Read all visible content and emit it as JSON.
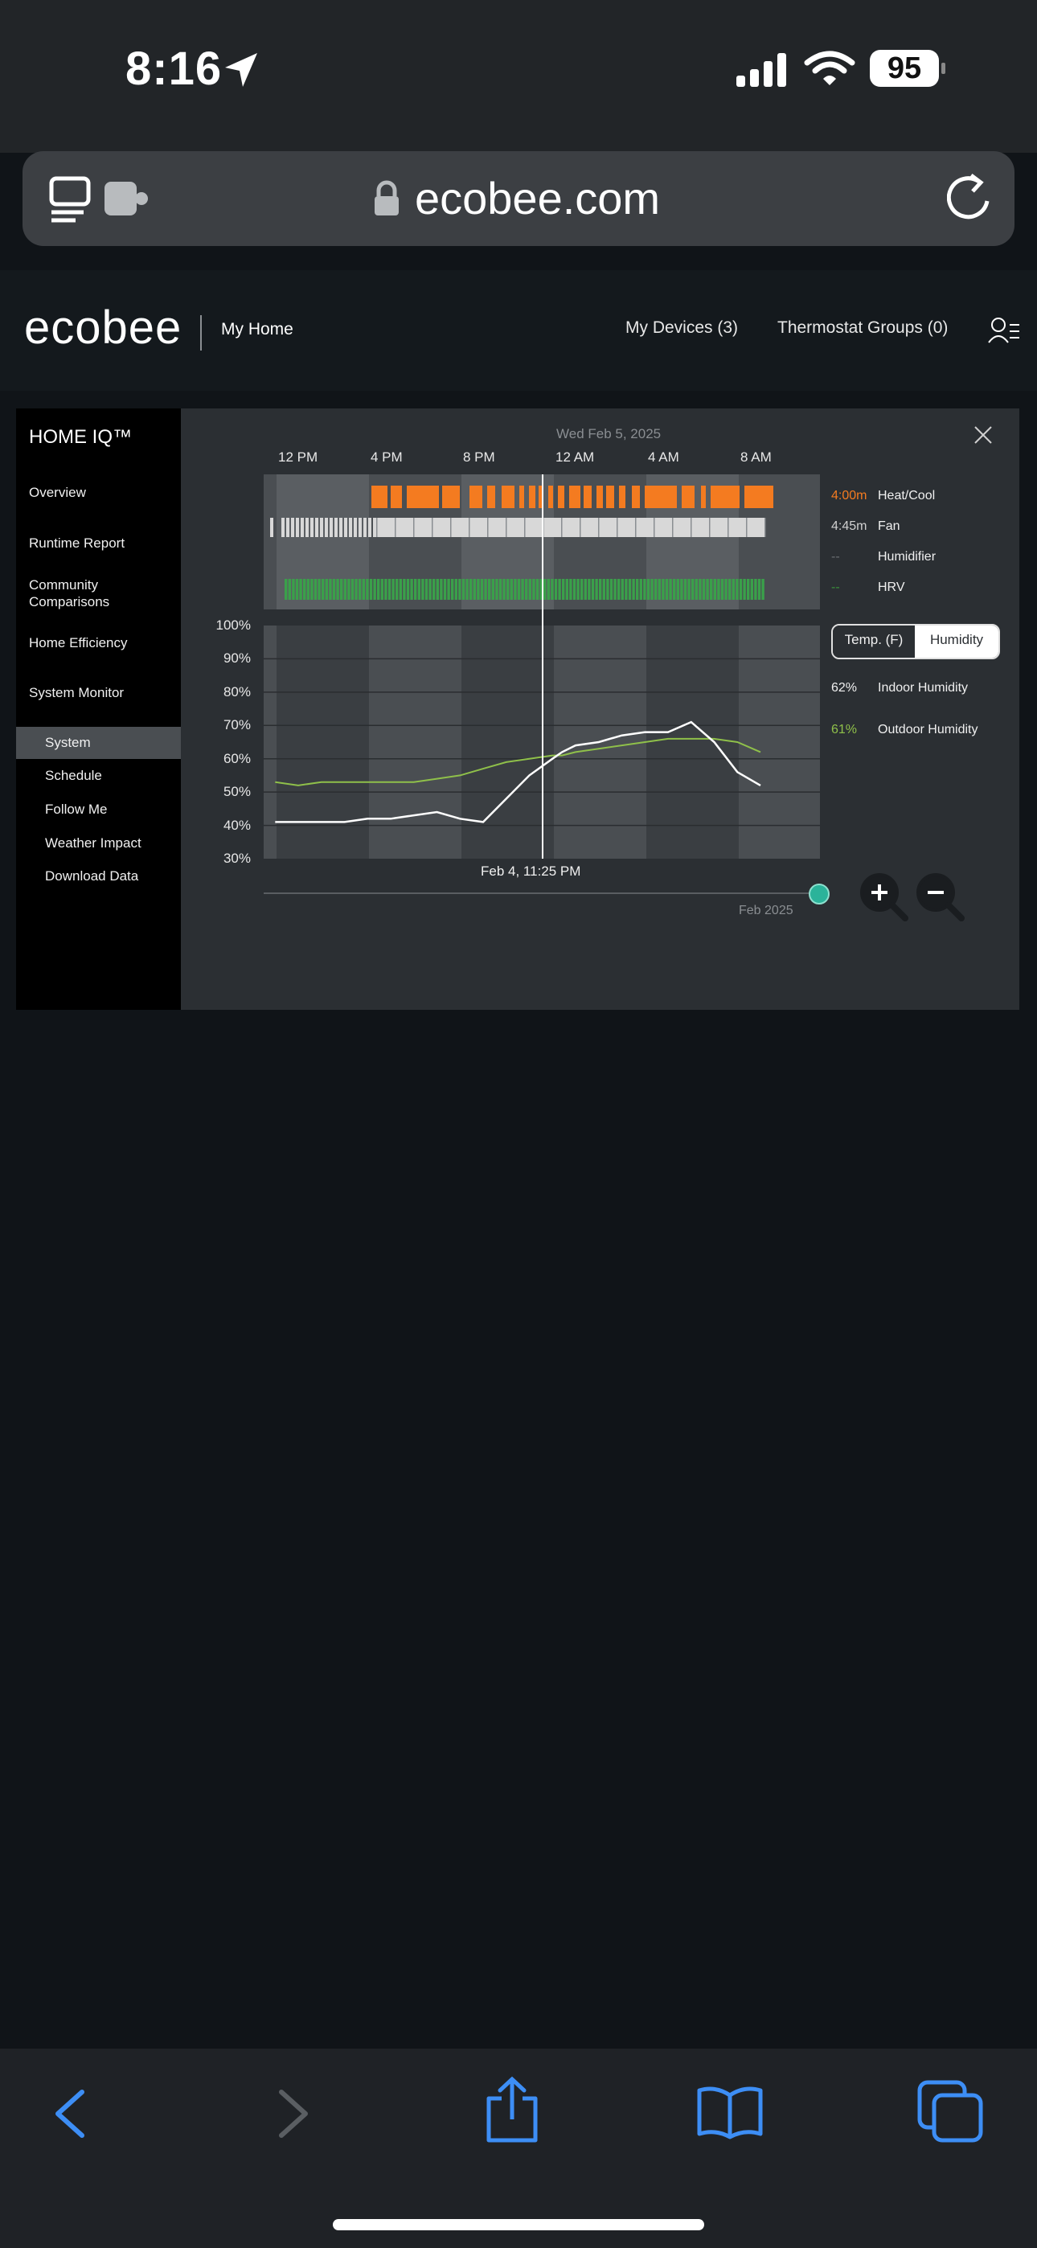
{
  "status": {
    "time": "8:16",
    "battery": "95"
  },
  "browser": {
    "url": "ecobee.com"
  },
  "header": {
    "logo": "ecobee",
    "home_name": "My Home",
    "my_devices": "My Devices  (3)",
    "thermostat_groups": "Thermostat Groups  (0)"
  },
  "sidebar": {
    "title": "HOME IQ™",
    "items": [
      "Overview",
      "Runtime Report",
      "Community",
      "Comparisons",
      "Home Efficiency",
      "System Monitor"
    ],
    "sub_items": [
      "System",
      "Schedule",
      "Follow Me",
      "Weather Impact",
      "Download Data"
    ]
  },
  "chart": {
    "date_title": "Wed Feb 5, 2025",
    "time_ticks": [
      "12 PM",
      "4 PM",
      "8 PM",
      "12 AM",
      "4 AM",
      "8 AM"
    ],
    "y_ticks": [
      "100%",
      "90%",
      "80%",
      "70%",
      "60%",
      "50%",
      "40%",
      "30%"
    ],
    "cursor_label": "Feb 4, 11:25 PM",
    "scrubber_label": "Feb 2025",
    "legend": [
      {
        "value": "4:00m",
        "label": "Heat/Cool",
        "color": "#f47b20"
      },
      {
        "value": "4:45m",
        "label": "Fan",
        "color": "#d0d0d0"
      },
      {
        "value": "--",
        "label": "Humidifier",
        "color": "#6a6e72"
      },
      {
        "value": "--",
        "label": "HRV",
        "color": "#3a8f3a"
      }
    ],
    "toggle": {
      "temp": "Temp. (F)",
      "humidity": "Humidity"
    },
    "readings": [
      {
        "value": "62%",
        "label": "Indoor Humidity",
        "color": "#f0f0f0"
      },
      {
        "value": "61%",
        "label": "Outdoor Humidity",
        "color": "#8fc04a"
      }
    ]
  },
  "chart_data": {
    "type": "line",
    "title": "Wed Feb 5, 2025",
    "xlabel": "",
    "ylabel": "",
    "x_ticks": [
      "12 PM",
      "4 PM",
      "8 PM",
      "12 AM",
      "4 AM",
      "8 AM"
    ],
    "ylim": [
      30,
      100
    ],
    "series": [
      {
        "name": "Indoor Humidity",
        "color": "#ffffff",
        "x": [
          "11:00",
          "12:00",
          "13:00",
          "14:00",
          "15:00",
          "16:00",
          "17:00",
          "18:00",
          "19:00",
          "20:00",
          "21:00",
          "22:00",
          "23:00",
          "23:25",
          "00:00",
          "01:00",
          "02:00",
          "03:00",
          "04:00",
          "05:00",
          "06:00",
          "07:00",
          "08:00"
        ],
        "values": [
          41,
          41,
          41,
          41,
          42,
          42,
          43,
          44,
          42,
          41,
          48,
          55,
          60,
          62,
          64,
          65,
          67,
          68,
          68,
          71,
          65,
          56,
          52
        ]
      },
      {
        "name": "Outdoor Humidity",
        "color": "#8fc04a",
        "x": [
          "11:00",
          "12:00",
          "13:00",
          "14:00",
          "15:00",
          "16:00",
          "17:00",
          "18:00",
          "19:00",
          "20:00",
          "21:00",
          "22:00",
          "23:00",
          "23:25",
          "00:00",
          "01:00",
          "02:00",
          "03:00",
          "04:00",
          "05:00",
          "06:00",
          "07:00",
          "08:00"
        ],
        "values": [
          53,
          52,
          53,
          53,
          53,
          53,
          53,
          54,
          55,
          57,
          59,
          60,
          61,
          61,
          62,
          63,
          64,
          65,
          66,
          66,
          66,
          65,
          62
        ]
      }
    ]
  }
}
